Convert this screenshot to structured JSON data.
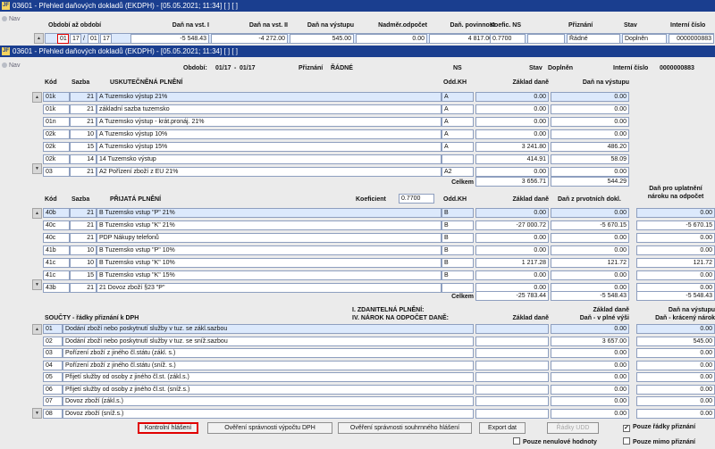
{
  "window_back": {
    "title": "03601 - Přehled daňových dokladů (EKDPH) - [05.05.2021; 11:34] [ ] [ ]"
  },
  "nav_label": "Nav",
  "overview": {
    "headers": [
      "Období až období",
      "Daň na vst. I",
      "Daň na vst. II",
      "Daň na výstupu",
      "Nadměr.odpočet",
      "Daň. povinnost",
      "Koefic. NS",
      "Přiznání",
      "Stav",
      "Interní číslo"
    ],
    "row": {
      "od_m": "01",
      "od_y": "17",
      "slash": "/",
      "do_m": "01",
      "do_y": "17",
      "dan_vst1": "-5 548.43",
      "dan_vst2": "-4 272.00",
      "dan_vyst": "545.00",
      "nadmer": "0.00",
      "povinnost": "4 817.00",
      "koef": "0.7700",
      "prizn": "Řádné",
      "stav": "Doplněn",
      "interni": "0000000883"
    }
  },
  "window_front": {
    "title": "03601 - Přehled daňových dokladů (EKDPH) - [05.05.2021; 11:34] [ ] [ ]"
  },
  "info": {
    "obdobi_label": "Období:",
    "obdobi_value": "01/17",
    "obdobi_sep": "-",
    "obdobi_to": "01/17",
    "prizn_label": "Přiznání",
    "prizn_value": "ŘÁDNÉ",
    "ns": "NS",
    "stav_label": "Stav",
    "stav_value": "Doplněn",
    "interni_label": "Interní číslo",
    "interni_value": "0000000883"
  },
  "uskut": {
    "headers": {
      "kod": "Kód",
      "sazba": "Sazba",
      "nazev": "USKUTEČNĚNÁ PLNĚNÍ",
      "oddkh": "Odd.KH",
      "zaklad": "Základ daně",
      "dan": "Daň na výstupu"
    },
    "rows": [
      {
        "kod": "01k",
        "sazba": "21",
        "nazev": "A  Tuzemsko výstup 21%",
        "odd": "A",
        "zaklad": "0.00",
        "dan": "0.00"
      },
      {
        "kod": "01k",
        "sazba": "21",
        "nazev": "základní sazba tuzemsko",
        "odd": "A",
        "zaklad": "0.00",
        "dan": "0.00"
      },
      {
        "kod": "01n",
        "sazba": "21",
        "nazev": "A  Tuzemsko výstup - krát.pronáj. 21%",
        "odd": "A",
        "zaklad": "0.00",
        "dan": "0.00"
      },
      {
        "kod": "02k",
        "sazba": "10",
        "nazev": "A  Tuzemsko výstup 10%",
        "odd": "A",
        "zaklad": "0.00",
        "dan": "0.00"
      },
      {
        "kod": "02k",
        "sazba": "15",
        "nazev": "A  Tuzemsko výstup 15%",
        "odd": "A",
        "zaklad": "3 241.80",
        "dan": "486.20"
      },
      {
        "kod": "02k",
        "sazba": "14",
        "nazev": "14  Tuzemsko výstup",
        "odd": "",
        "zaklad": "414.91",
        "dan": "58.09"
      },
      {
        "kod": "03",
        "sazba": "21",
        "nazev": "A2  Pořízení zboží z EU 21%",
        "odd": "A2",
        "zaklad": "0.00",
        "dan": "0.00"
      }
    ],
    "celkem_label": "Celkem",
    "celkem_zaklad": "3 656.71",
    "celkem_dan": "544.29"
  },
  "prij": {
    "headers": {
      "kod": "Kód",
      "sazba": "Sazba",
      "nazev": "PŘIJATÁ PLNĚNÍ",
      "koef_label": "Koeficient",
      "koef_value": "0.7700",
      "oddkh": "Odd.KH",
      "zaklad": "Základ daně",
      "dan1": "Daň z prvotních dokl.",
      "dan2_l1": "Daň pro uplatnění",
      "dan2_l2": "nároku na odpočet"
    },
    "rows": [
      {
        "kod": "40b",
        "sazba": "21",
        "nazev": "B  Tuzemsko vstup \"P\" 21%",
        "odd": "B",
        "zaklad": "0.00",
        "dan1": "0.00",
        "dan2": "0.00"
      },
      {
        "kod": "40c",
        "sazba": "21",
        "nazev": "B  Tuzemsko vstup \"K\" 21%",
        "odd": "B",
        "zaklad": "-27 000.72",
        "dan1": "-5 670.15",
        "dan2": "-5 670.15"
      },
      {
        "kod": "40c",
        "sazba": "21",
        "nazev": "PDP Nákupy telefonů",
        "odd": "B",
        "zaklad": "0.00",
        "dan1": "0.00",
        "dan2": "0.00"
      },
      {
        "kod": "41b",
        "sazba": "10",
        "nazev": "B  Tuzemsko vstup \"P\" 10%",
        "odd": "B",
        "zaklad": "0.00",
        "dan1": "0.00",
        "dan2": "0.00"
      },
      {
        "kod": "41c",
        "sazba": "10",
        "nazev": "B  Tuzemsko vstup \"K\" 10%",
        "odd": "B",
        "zaklad": "1 217.28",
        "dan1": "121.72",
        "dan2": "121.72"
      },
      {
        "kod": "41c",
        "sazba": "15",
        "nazev": "B  Tuzemsko vstup \"K\" 15%",
        "odd": "B",
        "zaklad": "0.00",
        "dan1": "0.00",
        "dan2": "0.00"
      },
      {
        "kod": "43b",
        "sazba": "21",
        "nazev": "21  Dovoz zboží §23 \"P\"",
        "odd": "",
        "zaklad": "0.00",
        "dan1": "0.00",
        "dan2": "0.00"
      }
    ],
    "celkem_label": "Celkem",
    "celkem_zaklad": "-25 783.44",
    "celkem_dan1": "-5 548.43",
    "celkem_dan2": "-5 548.43"
  },
  "souc": {
    "title": "SOUČTY - řádky přiznání k DPH",
    "mid_l1": "I. ZDANITELNÁ PLNĚNÍ:",
    "mid_l2": "IV. NÁROK NA ODPOČET DANĚ:",
    "h_zaklad": "Základ daně",
    "h_c1_l1": "Základ daně",
    "h_c1_l2": "Daň - v plné výši",
    "h_c2_l1": "Daň na výstupu",
    "h_c2_l2": "Daň - krácený nárok",
    "rows": [
      {
        "kod": "01",
        "nazev": "Dodání zboží nebo poskytnutí služby v tuz. se zákl.sazbou",
        "zaklad": "",
        "c1": "0.00",
        "c2": "0.00"
      },
      {
        "kod": "02",
        "nazev": "Dodání zboží nebo poskytnutí služby v tuz. se sníž.sazbou",
        "zaklad": "",
        "c1": "3 657.00",
        "c2": "545.00"
      },
      {
        "kod": "03",
        "nazev": "Pořízení zboží z jiného čl.státu (zákl. s.)",
        "zaklad": "",
        "c1": "0.00",
        "c2": "0.00"
      },
      {
        "kod": "04",
        "nazev": "Pořízení zboží z jiného čl.státu (sníž. s.)",
        "zaklad": "",
        "c1": "0.00",
        "c2": "0.00"
      },
      {
        "kod": "05",
        "nazev": "Přijetí služby od osoby z jiného čl.st. (zákl.s.)",
        "zaklad": "",
        "c1": "0.00",
        "c2": "0.00"
      },
      {
        "kod": "06",
        "nazev": "Přijetí služby od osoby z jiného čl.st. (sníž.s.)",
        "zaklad": "",
        "c1": "0.00",
        "c2": "0.00"
      },
      {
        "kod": "07",
        "nazev": "Dovoz zboží (zákl.s.)",
        "zaklad": "",
        "c1": "0.00",
        "c2": "0.00"
      },
      {
        "kod": "08",
        "nazev": "Dovoz zboží (sníž.s.)",
        "zaklad": "",
        "c1": "0.00",
        "c2": "0.00"
      }
    ]
  },
  "buttons": {
    "kontrolni": "Kontrolní hlášení",
    "overeni_dph": "Ověření správnosti výpočtu DPH",
    "overeni_souhrn": "Ověření správnosti souhrnného hlášení",
    "export": "Export dat",
    "radky_udd": "Řádky UDD"
  },
  "checks": {
    "pouze_radky": "Pouze řádky přiznání",
    "pouze_nenulove": "Pouze nenulové hodnoty",
    "pouze_mimo": "Pouze mimo přiznání"
  },
  "colors": {
    "title_bar": "#1a3e8f",
    "highlight": "#dce9fc",
    "focus_red": "#e00000"
  }
}
